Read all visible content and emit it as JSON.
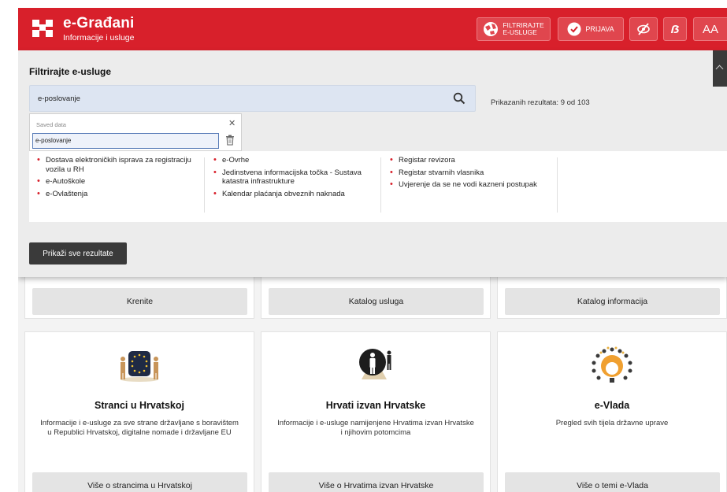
{
  "header": {
    "brand_title": "e-Građani",
    "brand_subtitle": "Informacije i usluge",
    "filter_label_1": "FILTRIRAJTE",
    "filter_label_2": "E-USLUGE",
    "login_label": "PRIJAVA",
    "dyslexia_label": "ẞ",
    "font_size_label": "AA",
    "accent_color": "#d8202b"
  },
  "filter": {
    "title": "Filtrirajte e-usluge",
    "search_value": "e-poslovanje",
    "results_count": "Prikazanih rezultata: 9 od 103",
    "autocomplete_header": "Saved data",
    "autocomplete_item": "e-poslovanje",
    "show_all_label": "Prikaži sve rezultate",
    "results": [
      [
        "Dostava elektroničkih isprava za registraciju vozila u RH",
        "e-Autoškole",
        "e-Ovlaštenja"
      ],
      [
        "e-Ovrhe",
        "Jedinstvena informacijska točka - Sustava katastra infrastrukture",
        "Kalendar plaćanja obveznih naknada"
      ],
      [
        "Registar revizora",
        "Registar stvarnih vlasnika",
        "Uvjerenje da se ne vodi kazneni postupak"
      ]
    ]
  },
  "cards_top": [
    "Krenite",
    "Katalog usluga",
    "Katalog informacija"
  ],
  "cards": [
    {
      "title": "Stranci u Hrvatskoj",
      "desc": "Informacije i e-usluge za sve strane državljane s boravištem u Republici Hrvatskoj, digitalne nomade i državljane EU",
      "button": "Više o strancima u Hrvatskoj"
    },
    {
      "title": "Hrvati izvan Hrvatske",
      "desc": "Informacije i e-usluge namijenjene Hrvatima izvan Hrvatske i njihovim potomcima",
      "button": "Više o Hrvatima izvan Hrvatske"
    },
    {
      "title": "e-Vlada",
      "desc": "Pregled svih tijela državne uprave",
      "button": "Više o temi e-Vlada"
    }
  ]
}
